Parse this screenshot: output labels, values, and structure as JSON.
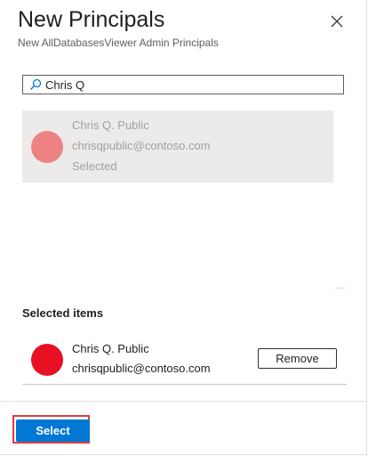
{
  "header": {
    "title": "New Principals",
    "subtitle": "New AllDatabasesViewer Admin Principals",
    "close_icon": "close-icon"
  },
  "search": {
    "value": "Chris Q",
    "icon": "search-icon"
  },
  "results": [
    {
      "name": "Chris Q. Public",
      "email": "chrisqpublic@contoso.com",
      "status": "Selected",
      "avatar_color": "#ee8182"
    }
  ],
  "selected": {
    "heading": "Selected items",
    "items": [
      {
        "name": "Chris Q. Public",
        "email": "chrisqpublic@contoso.com",
        "avatar_color": "#e81123",
        "remove_label": "Remove"
      }
    ]
  },
  "footer": {
    "select_label": "Select"
  },
  "colors": {
    "accent": "#0078d4",
    "highlight": "#e03c3c",
    "card_bg": "#edebe9"
  }
}
